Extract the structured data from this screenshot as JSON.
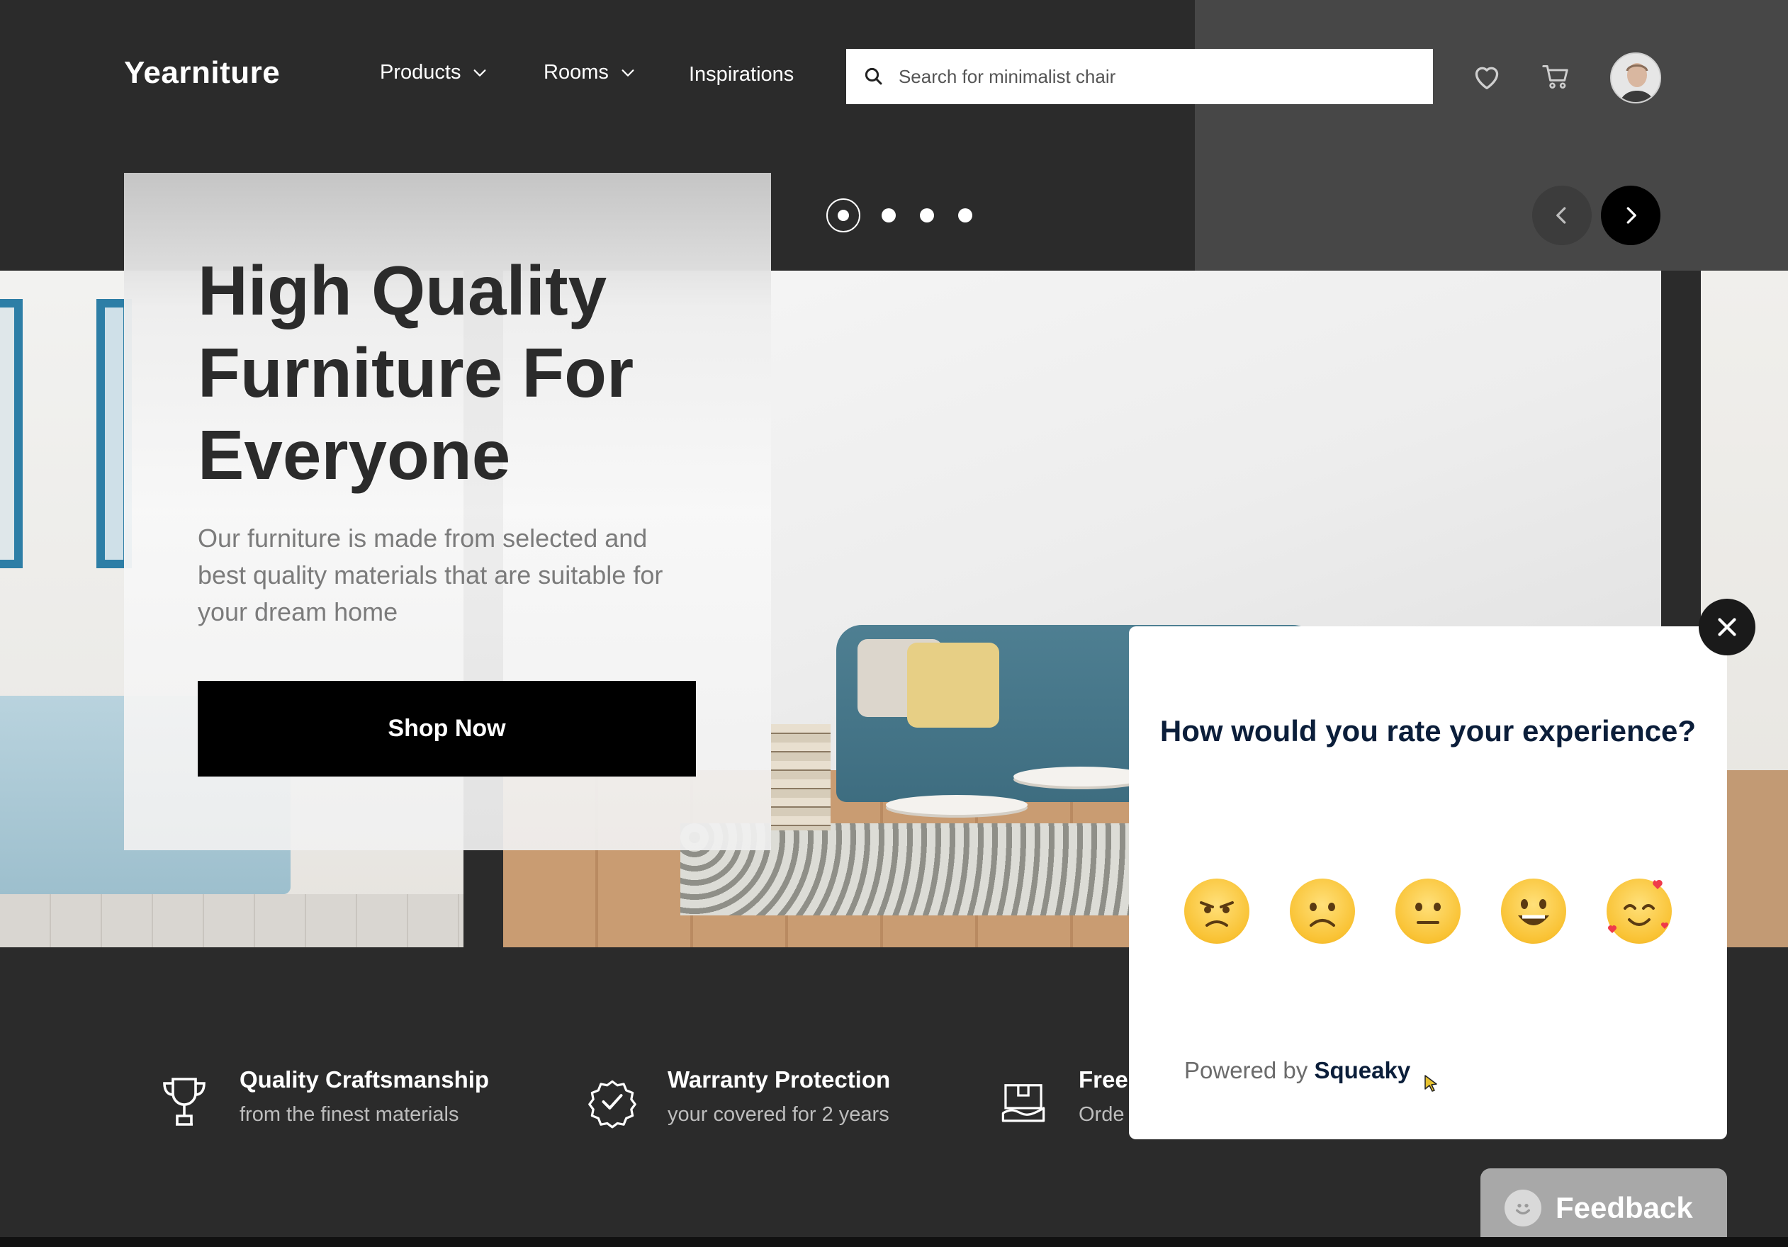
{
  "header": {
    "logo": "Yearniture",
    "nav": [
      {
        "label": "Products",
        "has_dropdown": true
      },
      {
        "label": "Rooms",
        "has_dropdown": true
      },
      {
        "label": "Inspirations",
        "has_dropdown": false
      }
    ],
    "search": {
      "placeholder": "Search for minimalist chair",
      "value": ""
    },
    "icons": [
      "heart-icon",
      "cart-icon",
      "avatar"
    ]
  },
  "carousel": {
    "slide_count": 4,
    "active_index": 0
  },
  "hero": {
    "title": "High Quality Furniture For Everyone",
    "subtitle": "Our furniture is made from selected and best quality materials that are suitable for your dream home",
    "cta_label": "Shop Now"
  },
  "features": [
    {
      "icon": "trophy-icon",
      "title": "Quality Craftsmanship",
      "subtitle": "from the finest materials"
    },
    {
      "icon": "check-badge-icon",
      "title": "Warranty Protection",
      "subtitle": "your covered for 2 years"
    },
    {
      "icon": "box-icon",
      "title": "Free",
      "subtitle": "Orde"
    }
  ],
  "feedback_popup": {
    "question": "How would you rate your experience?",
    "ratings": [
      "angry",
      "sad",
      "neutral",
      "happy",
      "love"
    ],
    "powered_by_prefix": "Powered by",
    "powered_by_brand": "Squeaky"
  },
  "feedback_tab": {
    "label": "Feedback"
  },
  "colors": {
    "background": "#2b2b2b",
    "accent_dark": "#000000",
    "popup_text": "#0b1e3a",
    "emoji_yellow": "#f9c233",
    "frame_blue": "#2d7ea6"
  }
}
